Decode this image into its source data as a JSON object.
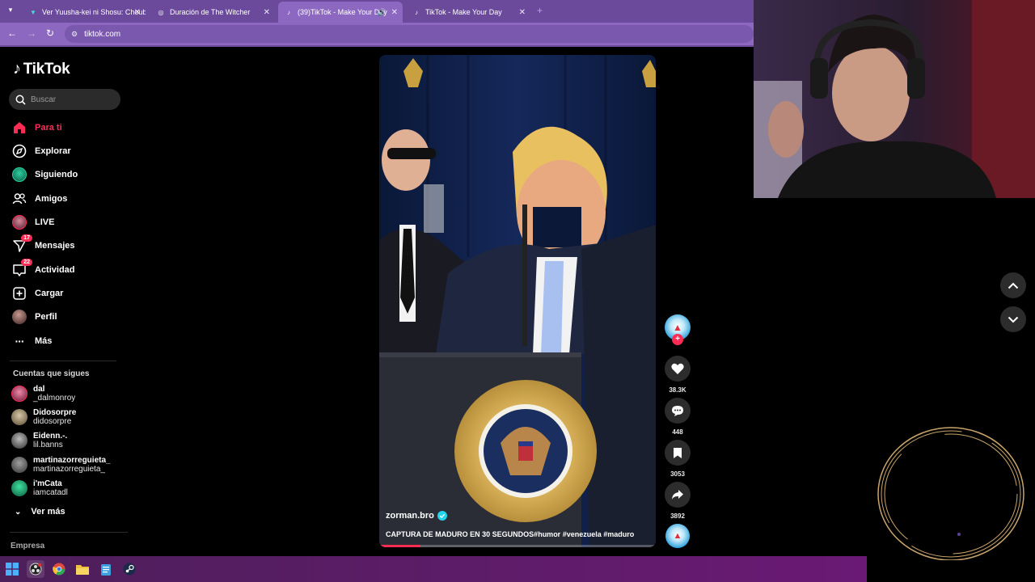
{
  "browser": {
    "tabs": [
      {
        "title": "Ver Yuusha-kei ni Shosu: Choub",
        "active": false
      },
      {
        "title": "Duración de The Witcher",
        "active": false
      },
      {
        "title": "(39)TikTok - Make Your Day",
        "active": true
      },
      {
        "title": "TikTok - Make Your Day",
        "active": false
      }
    ],
    "url": "tiktok.com"
  },
  "sidebar": {
    "logo": "TikTok",
    "search_placeholder": "Buscar",
    "nav": [
      {
        "label": "Para ti",
        "icon": "home-icon",
        "active": true
      },
      {
        "label": "Explorar",
        "icon": "compass-icon"
      },
      {
        "label": "Siguiendo",
        "icon": "following-avatar-icon"
      },
      {
        "label": "Amigos",
        "icon": "friends-icon"
      },
      {
        "label": "LIVE",
        "icon": "live-avatar-icon"
      },
      {
        "label": "Mensajes",
        "icon": "send-icon",
        "badge": "17"
      },
      {
        "label": "Actividad",
        "icon": "inbox-icon",
        "badge": "22"
      },
      {
        "label": "Cargar",
        "icon": "upload-icon"
      },
      {
        "label": "Perfil",
        "icon": "profile-avatar-icon"
      },
      {
        "label": "Más",
        "icon": "more-icon"
      }
    ],
    "following_title": "Cuentas que sigues",
    "following": [
      {
        "name": "dal",
        "handle": "_dalmonroy"
      },
      {
        "name": "Didosorpre",
        "handle": "didosorpre"
      },
      {
        "name": "Eidenn.-.",
        "handle": "lil.banns"
      },
      {
        "name": "martinazorreguieta_",
        "handle": "martinazorreguieta_"
      },
      {
        "name": "i'mCata",
        "handle": "iamcatadl"
      }
    ],
    "ver_mas": "Ver más",
    "footer": "Empresa"
  },
  "video": {
    "author": "zorman.bro",
    "verified": true,
    "caption": "CAPTURA DE MADURO EN 30 SEGUNDOS#humor #venezuela #maduro",
    "progress": 0.15
  },
  "actions": {
    "likes": "38.3K",
    "comments": "448",
    "saves": "3053",
    "shares": "3892"
  },
  "colors": {
    "accent": "#fe2c55",
    "browser_tab_bar": "#6b4a9c",
    "browser_toolbar": "#8c68c0",
    "ring": "#c9a46a"
  }
}
